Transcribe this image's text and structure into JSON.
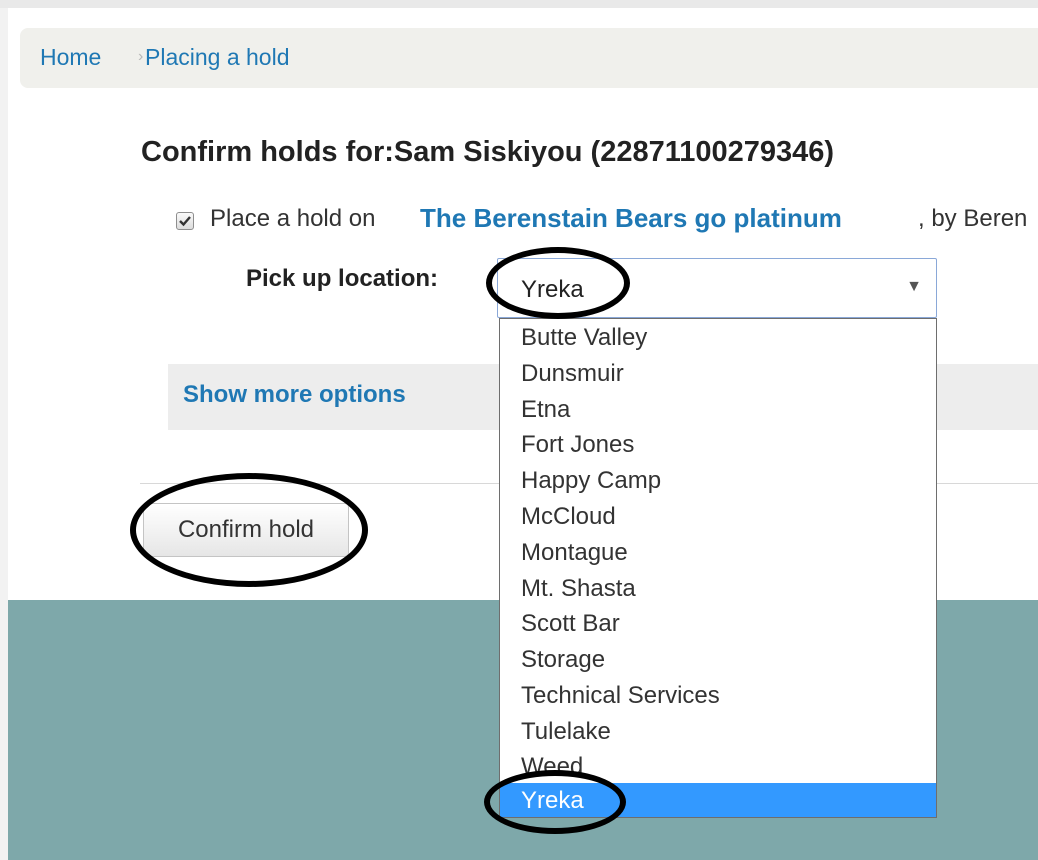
{
  "breadcrumb": {
    "home": "Home",
    "separator": "›",
    "current": "Placing a hold"
  },
  "page_title": "Confirm holds for:Sam Siskiyou (22871100279346)",
  "hold": {
    "checked": true,
    "prefix": "Place a hold on",
    "title": "The Berenstain Bears go platinum",
    "by": ", by Beren"
  },
  "pickup": {
    "label": "Pick up location:",
    "selected": "Yreka",
    "arrow": "▼",
    "options": [
      "Butte Valley",
      "Dunsmuir",
      "Etna",
      "Fort Jones",
      "Happy Camp",
      "McCloud",
      "Montague",
      "Mt. Shasta",
      "Scott Bar",
      "Storage",
      "Technical Services",
      "Tulelake",
      "Weed",
      "Yreka"
    ]
  },
  "more_options": "Show more options",
  "confirm_button": "Confirm hold",
  "colors": {
    "link": "#1f78b4",
    "footer": "#7ea8aa",
    "selected_option": "#3399ff"
  },
  "icons": {
    "checkbox": "checkmark-icon",
    "dropdown": "triangle-down-icon"
  }
}
